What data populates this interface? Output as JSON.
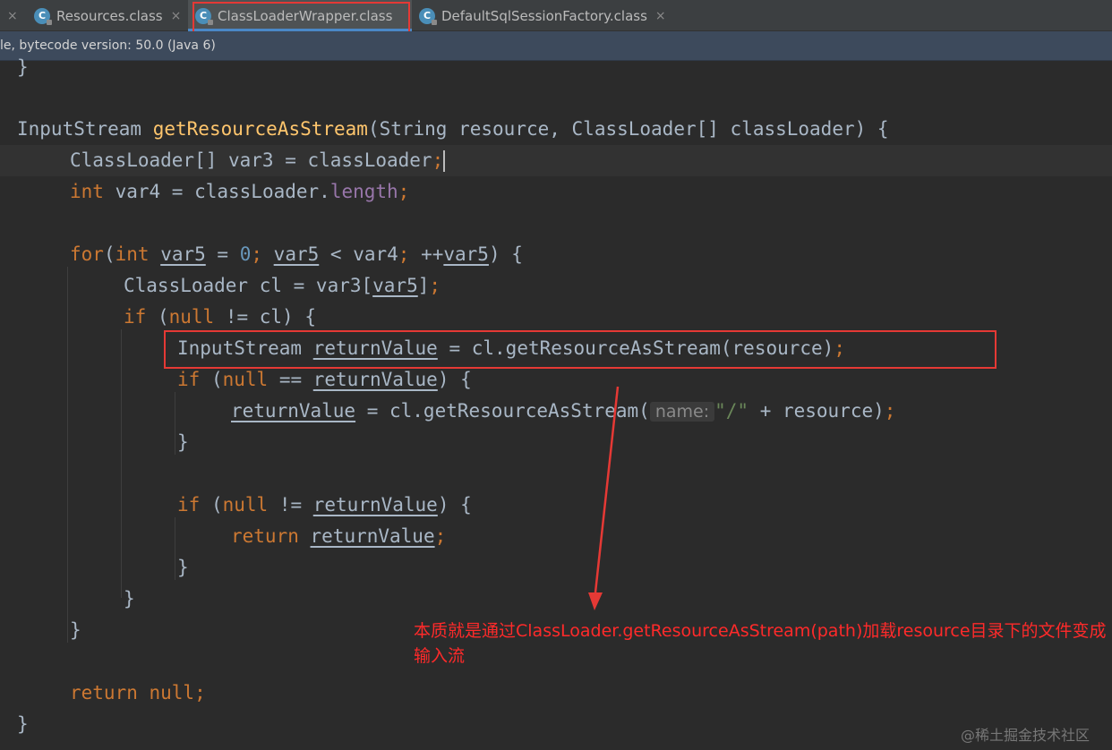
{
  "tabs": [
    {
      "label": "Resources.class",
      "active": false
    },
    {
      "label": "ClassLoaderWrapper.class",
      "active": true
    },
    {
      "label": "DefaultSqlSessionFactory.class",
      "active": false
    }
  ],
  "tab_icon_letter": "C",
  "tab_close_glyph": "×",
  "leading_close_glyph": "×",
  "info_text": "le, bytecode version: 50.0 (Java 6)",
  "code": {
    "closing_brace": "}",
    "method_return_type": "InputStream",
    "method_name": "getResourceAsStream",
    "method_params": "(String resource, ClassLoader[] classLoader) {",
    "var3_decl": "ClassLoader[] var3 = classLoader",
    "int_kw": "int",
    "var4_decl": " var4 = classLoader.",
    "length_field": "length",
    "semicolon": ";",
    "for_kw": "for",
    "var5": "var5",
    "zero": "0",
    "var4": "var4",
    "cl_decl": "ClassLoader cl = var3[",
    "if_kw": "if",
    "null_kw": "null",
    "not_eq_cl": " != cl) {",
    "input_stream": "InputStream",
    "return_value": "returnValue",
    "get_stream_call": " = cl.getResourceAsStream(resource)",
    "get_stream_call2": " = cl.getResourceAsStream(",
    "hint_name": "name:",
    "slash_str": "\"/\"",
    "plus_resource": " + resource)",
    "return_kw": "return",
    "return_null": "return null;"
  },
  "annotation_text": "本质就是通过ClassLoader.getResourceAsStream(path)加载resource目录下的文件变成输入流",
  "watermark": "@稀土掘金技术社区",
  "colors": {
    "keyword": "#cc7832",
    "method": "#ffc66d",
    "number": "#6897bb",
    "string": "#6a8759",
    "field": "#9876aa",
    "text": "#a9b7c6",
    "highlight_box": "#e53935",
    "annotation": "#ff2a2a"
  }
}
